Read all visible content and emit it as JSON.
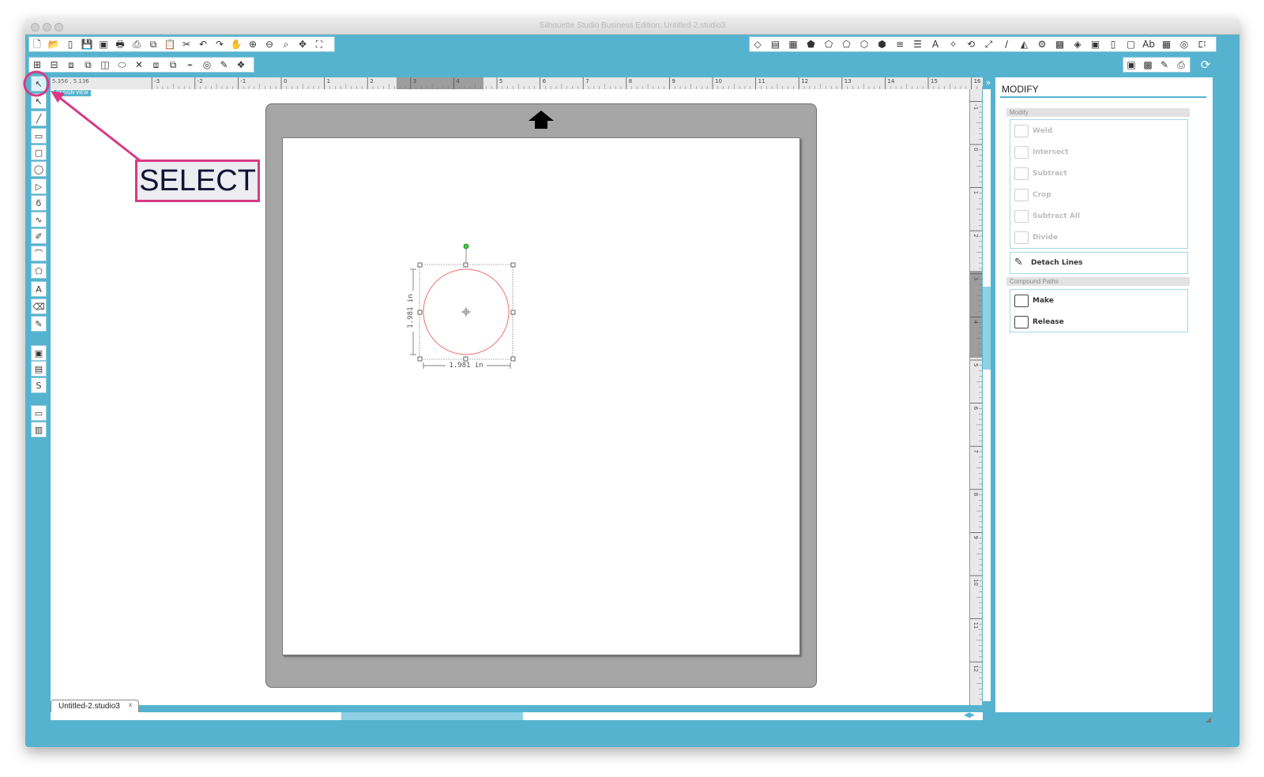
{
  "window": {
    "title": "Silhouette Studio Business Edition: Untitled-2.studio3"
  },
  "ruler": {
    "coords": "5.356 , 5.136",
    "h_ticks": [
      "-3",
      "-2",
      "-1",
      "0",
      "1",
      "2",
      "3",
      "4",
      "5",
      "6",
      "7",
      "8",
      "9",
      "10",
      "11",
      "12",
      "13",
      "14",
      "15",
      "16"
    ],
    "v_ticks": [
      "-1",
      "0",
      "1",
      "2",
      "3",
      "4",
      "5",
      "6",
      "7",
      "8",
      "9",
      "10",
      "11",
      "12"
    ]
  },
  "canvas": {
    "view_label": "DESIGN VIEW",
    "width_label": "1.981 in",
    "height_label": "1.981 in"
  },
  "toolbar_top_left": [
    {
      "name": "new-doc-icon",
      "glyph": "🗋"
    },
    {
      "name": "open-folder-icon",
      "glyph": "📂"
    },
    {
      "name": "open-library-icon",
      "glyph": "▯"
    },
    {
      "name": "save-icon",
      "glyph": "💾"
    },
    {
      "name": "save-library-icon",
      "glyph": "▣"
    },
    {
      "name": "print-icon",
      "glyph": "🖶"
    },
    {
      "name": "print-cut-icon",
      "glyph": "⎙"
    },
    {
      "name": "copy-icon",
      "glyph": "⧉"
    },
    {
      "name": "paste-icon",
      "glyph": "📋"
    },
    {
      "name": "cut-icon",
      "glyph": "✂"
    },
    {
      "name": "undo-icon",
      "glyph": "↶"
    },
    {
      "name": "redo-icon",
      "glyph": "↷"
    },
    {
      "name": "pan-icon",
      "glyph": "✋"
    },
    {
      "name": "zoom-in-icon",
      "glyph": "⊕"
    },
    {
      "name": "zoom-out-icon",
      "glyph": "⊖"
    },
    {
      "name": "zoom-select-icon",
      "glyph": "⌕"
    },
    {
      "name": "drag-zoom-icon",
      "glyph": "✥"
    },
    {
      "name": "fit-page-icon",
      "glyph": "⛶"
    }
  ],
  "toolbar_second_left": [
    {
      "name": "align-icon",
      "glyph": "⊞"
    },
    {
      "name": "distribute-icon",
      "glyph": "⊟"
    },
    {
      "name": "group-icon",
      "glyph": "⧈"
    },
    {
      "name": "ungroup-icon",
      "glyph": "⧉"
    },
    {
      "name": "compound-icon",
      "glyph": "◫"
    },
    {
      "name": "weld-icon",
      "glyph": "⬭"
    },
    {
      "name": "delete-icon",
      "glyph": "✕"
    },
    {
      "name": "bring-front-icon",
      "glyph": "⧈"
    },
    {
      "name": "send-back-icon",
      "glyph": "⧉"
    },
    {
      "name": "trace-icon",
      "glyph": "⌁"
    },
    {
      "name": "offset-icon",
      "glyph": "◎"
    },
    {
      "name": "knife-icon",
      "glyph": "✎"
    },
    {
      "name": "replicate-icon",
      "glyph": "❖"
    }
  ],
  "toolbar_top_right": [
    {
      "name": "fill-color-icon",
      "glyph": "◇"
    },
    {
      "name": "fill-gradient-icon",
      "glyph": "▤"
    },
    {
      "name": "fill-pattern-icon",
      "glyph": "▦"
    },
    {
      "name": "line-color-icon",
      "glyph": "⬟"
    },
    {
      "name": "line-style-icon",
      "glyph": "⬠"
    },
    {
      "name": "shadow-icon",
      "glyph": "⬠"
    },
    {
      "name": "sketch-icon",
      "glyph": "⬡"
    },
    {
      "name": "object-icon",
      "glyph": "⬢"
    },
    {
      "name": "lines-icon",
      "glyph": "≡"
    },
    {
      "name": "line-weight-icon",
      "glyph": "☰"
    },
    {
      "name": "text-style-icon",
      "glyph": "A"
    },
    {
      "name": "transform-icon",
      "glyph": "✧"
    },
    {
      "name": "rotate-icon",
      "glyph": "⟲"
    },
    {
      "name": "scale-icon",
      "glyph": "⤢"
    },
    {
      "name": "shear-icon",
      "glyph": "∕"
    },
    {
      "name": "mirror-icon",
      "glyph": "◭"
    },
    {
      "name": "warp-icon",
      "glyph": "⚙"
    },
    {
      "name": "nest-icon",
      "glyph": "▩"
    },
    {
      "name": "modify-icon",
      "glyph": "◈"
    },
    {
      "name": "offset-panel-icon",
      "glyph": "▣"
    },
    {
      "name": "page-setup-icon",
      "glyph": "▯"
    },
    {
      "name": "page-icon",
      "glyph": "▢"
    },
    {
      "name": "text-icon",
      "glyph": "Ab"
    },
    {
      "name": "grid-icon",
      "glyph": "▦"
    },
    {
      "name": "layers-icon",
      "glyph": "◎"
    },
    {
      "name": "library-icon",
      "glyph": "⊡"
    }
  ],
  "toolbar_second_right": [
    {
      "name": "design-store-icon",
      "glyph": "▣"
    },
    {
      "name": "pixscan-icon",
      "glyph": "▩"
    },
    {
      "name": "send-icon",
      "glyph": "✎"
    },
    {
      "name": "send-print-icon",
      "glyph": "⎙"
    }
  ],
  "left_tools": [
    {
      "name": "select-tool-icon",
      "glyph": "↖"
    },
    {
      "name": "point-edit-tool-icon",
      "glyph": "↖"
    },
    {
      "name": "line-tool-icon",
      "glyph": "╱"
    },
    {
      "name": "rectangle-tool-icon",
      "glyph": "▭"
    },
    {
      "name": "rounded-rect-tool-icon",
      "glyph": "▢"
    },
    {
      "name": "ellipse-tool-icon",
      "glyph": "◯"
    },
    {
      "name": "polygon-tool-icon",
      "glyph": "▷"
    },
    {
      "name": "curve-tool-icon",
      "glyph": "ϭ"
    },
    {
      "name": "freehand-tool-icon",
      "glyph": "∿"
    },
    {
      "name": "draw-tool-icon",
      "glyph": "✐"
    },
    {
      "name": "arc-tool-icon",
      "glyph": "⌒"
    },
    {
      "name": "regular-polygon-tool-icon",
      "glyph": "⬠"
    },
    {
      "name": "text-tool-icon",
      "glyph": "A"
    },
    {
      "name": "eraser-tool-icon",
      "glyph": "⌫"
    },
    {
      "name": "knife-tool-icon",
      "glyph": "✎"
    },
    {
      "name": "design-view-icon",
      "glyph": "▣"
    },
    {
      "name": "library-view-icon",
      "glyph": "▤"
    },
    {
      "name": "store-view-icon",
      "glyph": "S"
    },
    {
      "name": "send-view-icon",
      "glyph": "▭"
    },
    {
      "name": "panel-view-icon",
      "glyph": "▥"
    }
  ],
  "modify_panel": {
    "title": "MODIFY",
    "modify_section": "Modify",
    "items": [
      {
        "name": "weld-button",
        "label": "Weld",
        "enabled": false
      },
      {
        "name": "intersect-button",
        "label": "Intersect",
        "enabled": false
      },
      {
        "name": "subtract-button",
        "label": "Subtract",
        "enabled": false
      },
      {
        "name": "crop-button",
        "label": "Crop",
        "enabled": false
      },
      {
        "name": "subtract-all-button",
        "label": "Subtract All",
        "enabled": false
      },
      {
        "name": "divide-button",
        "label": "Divide",
        "enabled": false
      }
    ],
    "detach_lines": "Detach Lines",
    "compound_section": "Compound Paths",
    "compound_items": [
      {
        "name": "make-button",
        "label": "Make"
      },
      {
        "name": "release-button",
        "label": "Release"
      }
    ]
  },
  "document_tab": {
    "label": "Untitled-2.studio3",
    "close": "x"
  },
  "callout": {
    "text": "SELECT"
  },
  "colors": {
    "frame": "#56b3cf",
    "accent": "#d83a84",
    "mat": "#a6a6a6",
    "shape_stroke": "#f06a6a",
    "rotate_handle": "#3ccf3c"
  }
}
